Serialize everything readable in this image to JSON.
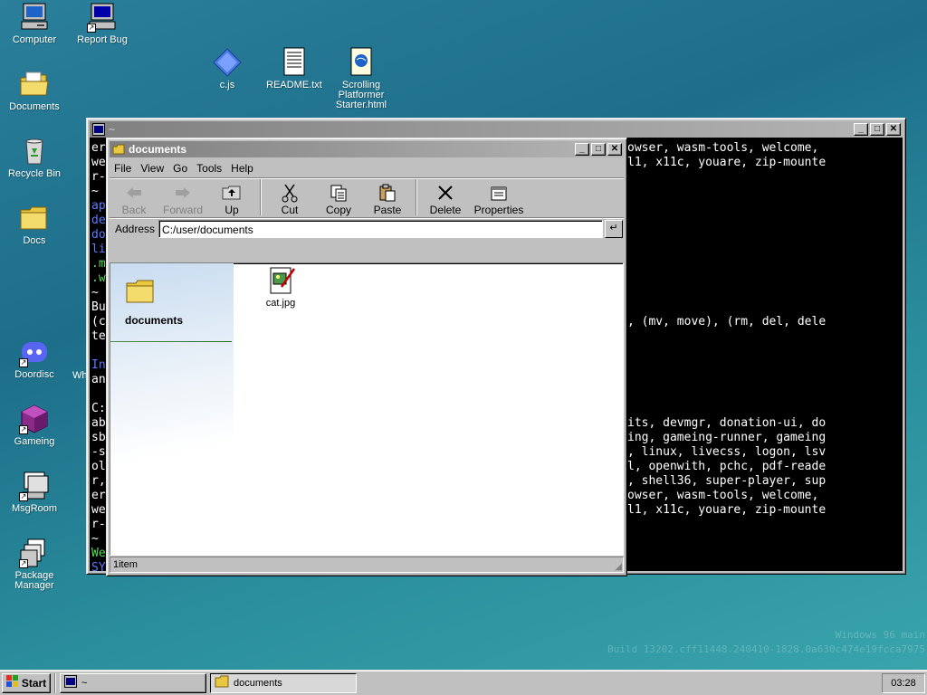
{
  "desktop": {
    "icons": [
      {
        "label": "Computer"
      },
      {
        "label": "Report Bug"
      },
      {
        "label": "c.js"
      },
      {
        "label": "README.txt"
      },
      {
        "label": "Scrolling Platformer Starter.html"
      },
      {
        "label": "Documents"
      },
      {
        "label": "Recycle Bin"
      },
      {
        "label": "Docs"
      },
      {
        "label": "Doordisc"
      },
      {
        "label": "Gameing"
      },
      {
        "label": "MsgRoom"
      },
      {
        "label": "Package Manager"
      }
    ],
    "partial_label": "Wh",
    "watermark": {
      "line1": "Windows 96 main",
      "line2": "Build 13202.cff11448.240410-1828.0a630c474e19fcca7975"
    }
  },
  "terminal": {
    "title": "~",
    "left_fragments": [
      {
        "text": "er",
        "color": "#ffffff"
      },
      {
        "text": "we",
        "color": "#ffffff"
      },
      {
        "text": "r-",
        "color": "#ffffff"
      },
      {
        "text": "~ $",
        "color": "#ffffff"
      },
      {
        "text": "ap",
        "color": "#5b7bff"
      },
      {
        "text": "de",
        "color": "#5b7bff"
      },
      {
        "text": "do",
        "color": "#5b7bff"
      },
      {
        "text": "li",
        "color": "#5b7bff"
      },
      {
        "text": ".m",
        "color": "#55dd55"
      },
      {
        "text": ".w",
        "color": "#55dd55"
      },
      {
        "text": "~ $",
        "color": "#ffffff"
      },
      {
        "text": "Bu",
        "color": "#ffffff"
      },
      {
        "text": "(c",
        "color": "#ffffff"
      },
      {
        "text": "te",
        "color": "#ffffff"
      },
      {
        "text": "",
        "color": "#ffffff"
      },
      {
        "text": "In",
        "color": "#5b7bff"
      },
      {
        "text": "an",
        "color": "#ffffff"
      },
      {
        "text": "",
        "color": "#ffffff"
      },
      {
        "text": "C:",
        "color": "#ffffff"
      },
      {
        "text": "ab",
        "color": "#ffffff"
      },
      {
        "text": "sb",
        "color": "#ffffff"
      },
      {
        "text": "-s",
        "color": "#ffffff"
      },
      {
        "text": "ol",
        "color": "#ffffff"
      },
      {
        "text": "r,",
        "color": "#ffffff"
      },
      {
        "text": "er",
        "color": "#ffffff"
      },
      {
        "text": "we",
        "color": "#ffffff"
      },
      {
        "text": "r-",
        "color": "#ffffff"
      },
      {
        "text": "~ $",
        "color": "#ffffff"
      },
      {
        "text": "We",
        "color": "#55dd55"
      },
      {
        "text": "SY",
        "color": "#5b7bff"
      }
    ],
    "right_fragments": [
      {
        "text": "owser, wasm-tools, welcome,"
      },
      {
        "text": "l1, x11c, youare, zip-mounte"
      },
      {
        "text": ", (mv, move), (rm, del, dele"
      },
      {
        "text": "its, devmgr, donation-ui, do"
      },
      {
        "text": "ing, gameing-runner, gameing"
      },
      {
        "text": ", linux, livecss, logon, lsv"
      },
      {
        "text": "l, openwith, pchc, pdf-reade"
      },
      {
        "text": ", shell36, super-player, sup"
      },
      {
        "text": "owser, wasm-tools, welcome,"
      },
      {
        "text": "l1, x11c, youare, zip-mounte"
      }
    ]
  },
  "explorer": {
    "title": "documents",
    "menu": [
      "File",
      "View",
      "Go",
      "Tools",
      "Help"
    ],
    "toolbar": [
      {
        "label": "Back",
        "icon": "back-arrow-icon",
        "disabled": true
      },
      {
        "label": "Forward",
        "icon": "forward-arrow-icon",
        "disabled": true
      },
      {
        "label": "Up",
        "icon": "folder-up-icon",
        "disabled": false
      },
      {
        "label": "Cut",
        "icon": "scissors-icon",
        "disabled": false
      },
      {
        "label": "Copy",
        "icon": "copy-icon",
        "disabled": false
      },
      {
        "label": "Paste",
        "icon": "paste-icon",
        "disabled": false
      },
      {
        "label": "Delete",
        "icon": "delete-x-icon",
        "disabled": false
      },
      {
        "label": "Properties",
        "icon": "properties-icon",
        "disabled": false
      }
    ],
    "address_label": "Address",
    "address_value": "C:/user/documents",
    "sidebar_title": "documents",
    "files": [
      {
        "name": "cat.jpg",
        "icon": "image-file-icon"
      }
    ],
    "status": "1item"
  },
  "taskbar": {
    "start_label": "Start",
    "tasks": [
      {
        "label": "~",
        "icon": "terminal-icon"
      },
      {
        "label": "documents",
        "icon": "folder-icon"
      }
    ],
    "clock": "03:28"
  },
  "colors": {
    "desktop_top": "#2a7f9a",
    "desktop_bottom": "#3aa6ac",
    "chrome": "#c0c0c0",
    "terminal_bg": "#000000"
  }
}
